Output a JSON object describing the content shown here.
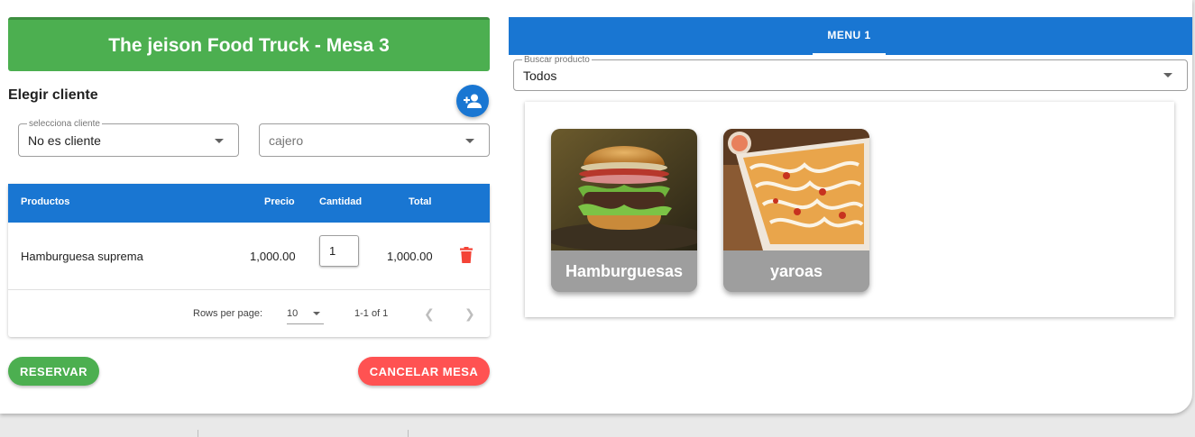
{
  "header": {
    "title": "The jeison Food Truck - Mesa 3"
  },
  "client": {
    "heading": "Elegir cliente",
    "add_client_icon": "person-add-icon",
    "client_select": {
      "legend": "selecciona cliente",
      "value": "No es cliente"
    },
    "cashier_select": {
      "placeholder": "cajero"
    }
  },
  "order_table": {
    "columns": [
      "Productos",
      "Precio",
      "Cantidad",
      "Total"
    ],
    "rows": [
      {
        "product": "Hamburguesa suprema",
        "price": "1,000.00",
        "quantity": "1",
        "total": "1,000.00"
      }
    ],
    "pagination": {
      "rows_per_page_label": "Rows per page:",
      "rows_per_page": "10",
      "range": "1-1 of 1"
    }
  },
  "actions": {
    "reserve_label": "RESERVAR",
    "cancel_label": "CANCELAR MESA",
    "reserve_color": "#4caf50",
    "cancel_color": "#ff5252"
  },
  "menu": {
    "tabs": [
      "MENU 1"
    ],
    "search": {
      "legend": "Buscar producto",
      "value": "Todos"
    },
    "categories": [
      {
        "name": "Hamburguesas",
        "image": "burger-photo"
      },
      {
        "name": "yaroas",
        "image": "yaroa-photo"
      }
    ]
  },
  "colors": {
    "primary": "#1976d2",
    "success": "#4caf50",
    "danger": "#ff5252",
    "delete": "#f44336"
  }
}
